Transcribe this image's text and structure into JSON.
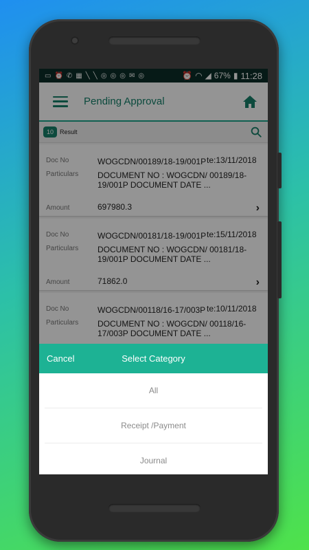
{
  "status_bar": {
    "battery": "67%",
    "time": "11:28"
  },
  "app_bar": {
    "title": "Pending Approval"
  },
  "results": {
    "count": "10",
    "label": "Result"
  },
  "labels": {
    "doc_no": "Doc No",
    "particulars": "Particulars",
    "amount": "Amount",
    "date_prefix": "Date"
  },
  "documents": [
    {
      "doc_no": "WOGCDN/00189/18-19/001P",
      "date": "te:13/11/2018",
      "particulars": "DOCUMENT NO : WOGCDN/ 00189/18-19/001P DOCUMENT DATE ...",
      "amount": "697980.3"
    },
    {
      "doc_no": "WOGCDN/00181/18-19/001P",
      "date": "te:15/11/2018",
      "particulars": "DOCUMENT NO : WOGCDN/ 00181/18-19/001P DOCUMENT DATE ...",
      "amount": "71862.0"
    },
    {
      "doc_no": "WOGCDN/00118/16-17/003P",
      "date": "te:10/11/2018",
      "particulars": "DOCUMENT NO : WOGCDN/ 00118/16-17/003P DOCUMENT DATE ...",
      "amount": ""
    }
  ],
  "category_sheet": {
    "cancel_label": "Cancel",
    "title": "Select Category",
    "options": [
      "All",
      "Receipt /Payment",
      "Journal"
    ]
  },
  "colors": {
    "accent": "#1db294",
    "primary_dark": "#17806a",
    "status_bar": "#0b2e28"
  }
}
